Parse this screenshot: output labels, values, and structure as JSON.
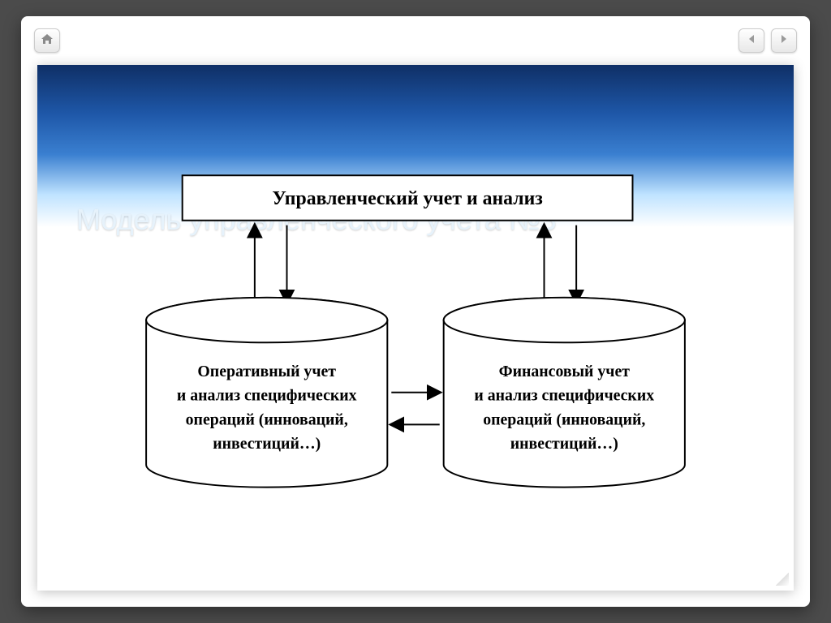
{
  "toolbar": {
    "home_icon_name": "home-icon",
    "prev_icon_name": "prev-icon",
    "next_icon_name": "next-icon"
  },
  "slide": {
    "title": "Модель управленческого учета №3"
  },
  "diagram": {
    "top_box_label": "Управленческий учет и анализ",
    "left_cylinder": {
      "line1": "Оперативный учет",
      "line2": "и анализ специфических",
      "line3": "операций (инноваций,",
      "line4": "инвестиций…)"
    },
    "right_cylinder": {
      "line1": "Финансовый учет",
      "line2": "и анализ специфических",
      "line3": "операций (инноваций,",
      "line4": "инвестиций…)"
    }
  }
}
